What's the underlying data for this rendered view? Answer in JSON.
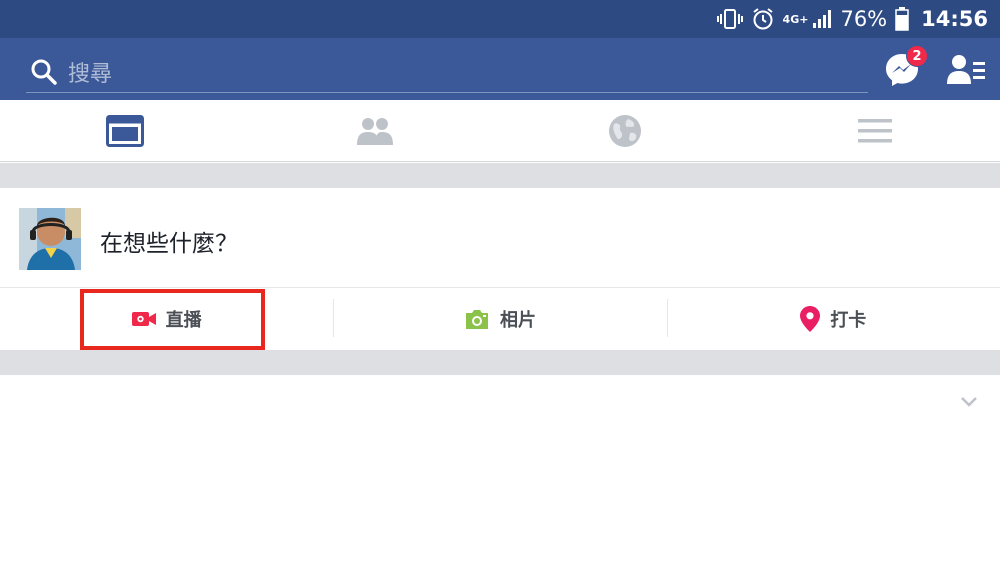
{
  "status_bar": {
    "network": "4G+",
    "battery_percent": "76%",
    "time": "14:56",
    "icons": [
      "vibrate-icon",
      "alarm-icon",
      "signal-icon",
      "battery-icon"
    ]
  },
  "search": {
    "placeholder": "搜尋"
  },
  "messenger": {
    "badge_count": "2"
  },
  "tabs": [
    {
      "name": "news-feed-tab",
      "icon": "news-feed-icon",
      "active": true
    },
    {
      "name": "friends-tab",
      "icon": "friends-icon",
      "active": false
    },
    {
      "name": "notifications-tab",
      "icon": "globe-icon",
      "active": false
    },
    {
      "name": "menu-tab",
      "icon": "hamburger-icon",
      "active": false
    }
  ],
  "composer": {
    "prompt": "在想些什麼？"
  },
  "actions": {
    "live_label": "直播",
    "photo_label": "相片",
    "checkin_label": "打卡"
  },
  "colors": {
    "header_blue": "#3b5998",
    "status_blue": "#2e4a83",
    "live_red": "#f02849",
    "photo_green": "#8bc34a",
    "checkin_pink": "#e91e63",
    "highlight_red": "#e8271f"
  }
}
